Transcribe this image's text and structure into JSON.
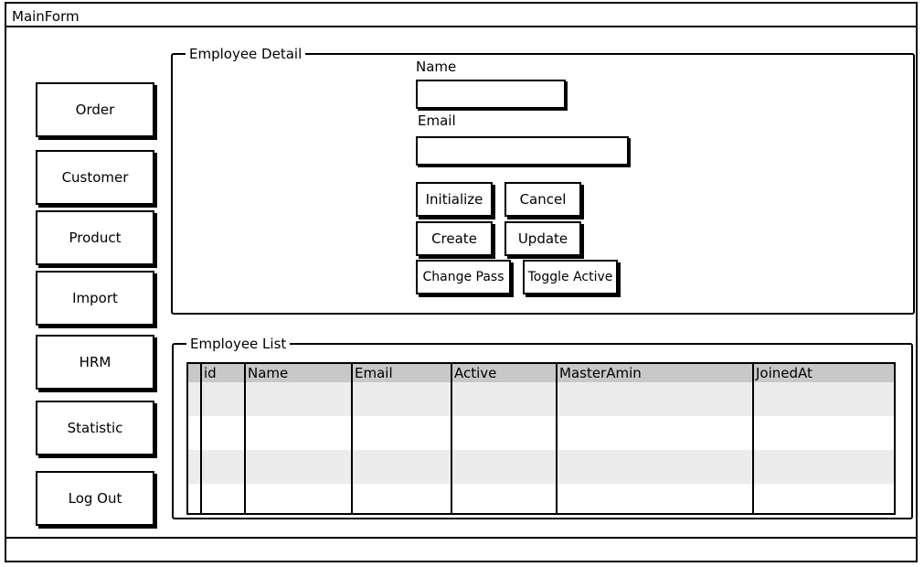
{
  "window": {
    "title": "MainForm"
  },
  "nav": {
    "items": [
      {
        "label": "Order",
        "key": "order"
      },
      {
        "label": "Customer",
        "key": "customer"
      },
      {
        "label": "Product",
        "key": "product"
      },
      {
        "label": "Import",
        "key": "import"
      },
      {
        "label": "HRM",
        "key": "hrm"
      },
      {
        "label": "Statistic",
        "key": "statistic"
      },
      {
        "label": "Log Out",
        "key": "log-out"
      }
    ]
  },
  "detail": {
    "legend": "Employee Detail",
    "name_label": "Name",
    "name_value": "",
    "email_label": "Email",
    "email_value": "",
    "buttons": {
      "initialize": "Initialize",
      "cancel": "Cancel",
      "create": "Create",
      "update": "Update",
      "change_pass": "Change Pass",
      "toggle_active": "Toggle Active"
    }
  },
  "list": {
    "legend": "Employee List",
    "columns": [
      "id",
      "Name",
      "Email",
      "Active",
      "MasterAmin",
      "JoinedAt"
    ],
    "rows": [
      [
        "",
        "",
        "",
        "",
        "",
        ""
      ],
      [
        "",
        "",
        "",
        "",
        "",
        ""
      ],
      [
        "",
        "",
        "",
        "",
        "",
        ""
      ],
      [
        "",
        "",
        "",
        "",
        "",
        ""
      ]
    ]
  }
}
